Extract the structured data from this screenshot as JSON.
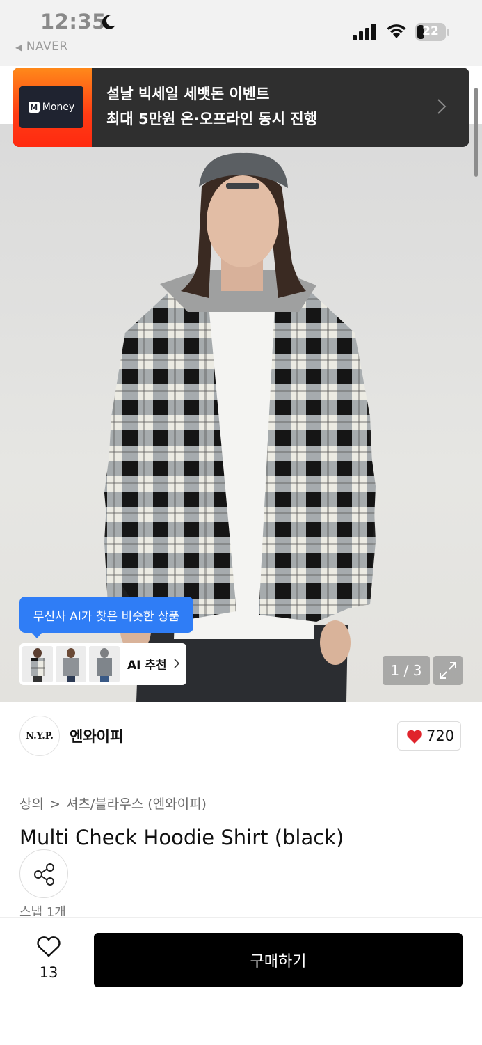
{
  "status_bar": {
    "time": "12:35",
    "back_app": "NAVER",
    "battery": "22"
  },
  "ad_banner": {
    "logo_text": "Money",
    "line1": "설날 빅세일 세뱃돈 이벤트",
    "line2": "최대 5만원 온·오프라인 동시 진행",
    "logo_bg": "#1f2330",
    "thumb_color": "#ff4a14"
  },
  "gallery": {
    "ai_tooltip": "무신사 AI가 찾은 비슷한 상품",
    "ai_recommend_label": "AI 추천",
    "page_counter": "1 / 3",
    "icons": [
      "expand-icon",
      "chevron-right-icon"
    ]
  },
  "brand": {
    "logo_text": "N.Y.P.",
    "name": "엔와이피",
    "like_count": "720"
  },
  "product": {
    "breadcrumb": [
      "상의",
      "셔츠/블라우스 (엔와이피)"
    ],
    "breadcrumb_sep": ">",
    "title": "Multi Check Hoodie Shirt (black)",
    "snap_count": "스냅 1개"
  },
  "bottom_bar": {
    "wish_count": "13",
    "buy_label": "구매하기"
  },
  "colors": {
    "accent_blue": "#2f7df6",
    "heart_red": "#e0242c",
    "buy_button": "#000000"
  }
}
